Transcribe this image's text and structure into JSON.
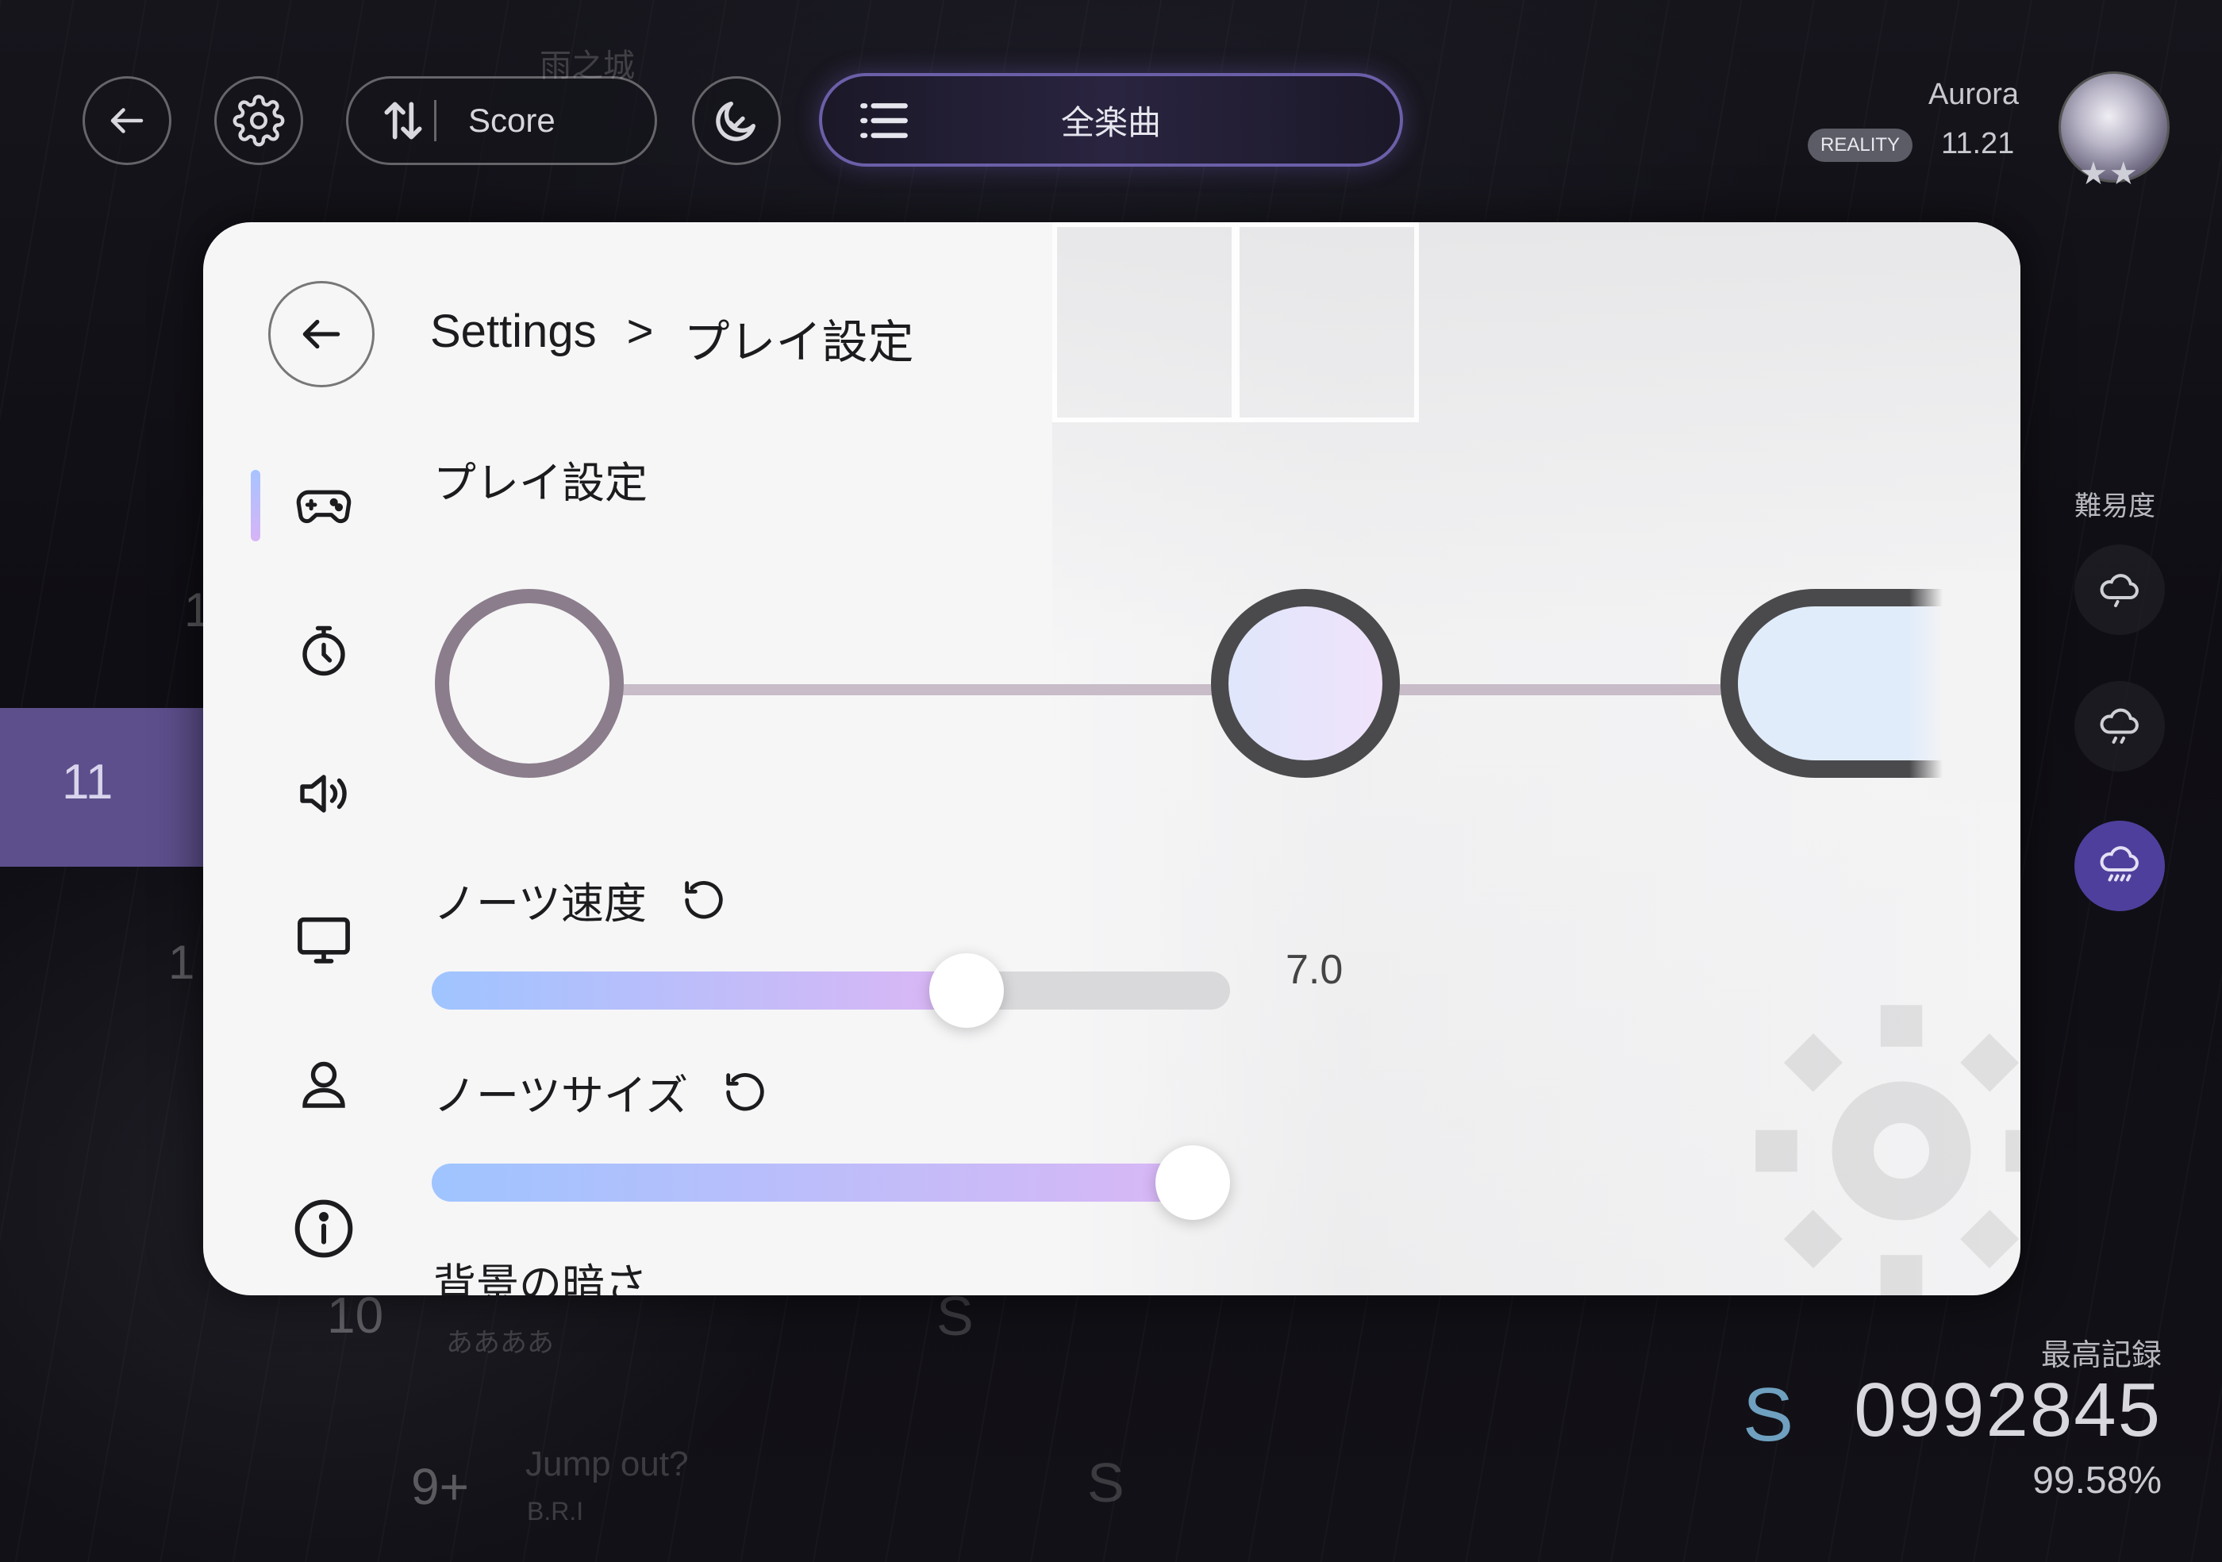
{
  "topbar": {
    "sort_label": "Score",
    "filter_label": "全楽曲",
    "bg_title": "雨之城"
  },
  "user": {
    "name": "Aurora",
    "badge": "REALITY",
    "rating": "11.21",
    "stars": "★★"
  },
  "song_list": {
    "selected_level": "11",
    "rows": [
      {
        "level": "1"
      },
      {
        "level": "1"
      },
      {
        "level": "10",
        "subtitle": "ああああ"
      },
      {
        "level": "9+",
        "title": "Jump out?",
        "artist": "B.R.I"
      }
    ],
    "rank_glyph": "S"
  },
  "difficulty": {
    "label": "難易度",
    "levels": [
      {
        "icon": "cloud-icon"
      },
      {
        "icon": "cloud-drizzle-icon"
      },
      {
        "icon": "cloud-rain-icon",
        "active": true
      }
    ]
  },
  "best": {
    "label": "最高記録",
    "rank": "S",
    "score": "0992845",
    "accuracy": "99.58%"
  },
  "settings": {
    "breadcrumb_root": "Settings",
    "breadcrumb_sep": ">",
    "breadcrumb_current": "プレイ設定",
    "section_title": "プレイ設定",
    "nav": [
      {
        "icon": "gamepad-icon",
        "active": true
      },
      {
        "icon": "timer-icon"
      },
      {
        "icon": "speaker-icon"
      },
      {
        "icon": "monitor-icon"
      },
      {
        "icon": "user-icon"
      },
      {
        "icon": "info-icon"
      }
    ],
    "note_speed": {
      "label": "ノーツ速度",
      "value": "7.0",
      "fraction": 0.67
    },
    "note_size": {
      "label": "ノーツサイズ",
      "fraction": 1.0
    },
    "bg_dim": {
      "label": "背景の暗さ"
    }
  },
  "colors": {
    "accent_purple": "#5d4f8c",
    "slider_start": "#9fc4ff",
    "slider_end": "#dcb6f5"
  }
}
